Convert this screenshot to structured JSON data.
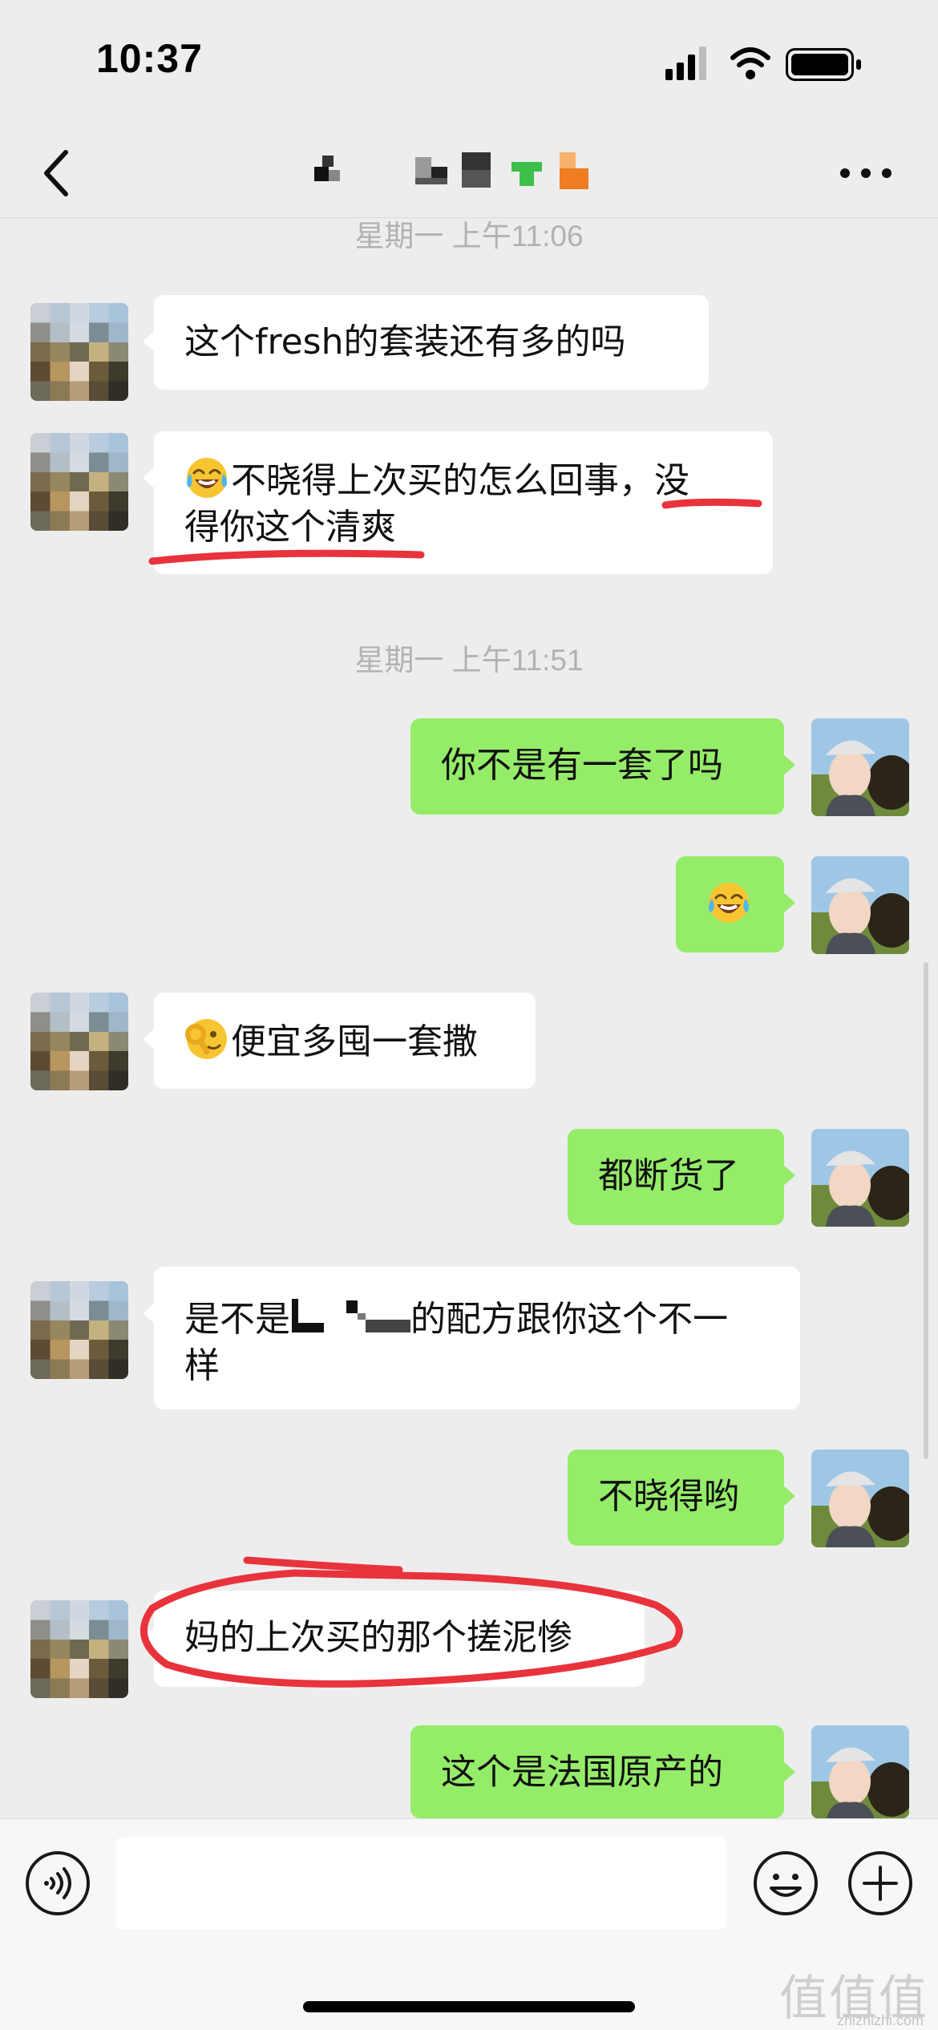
{
  "status_bar": {
    "time": "10:37",
    "icons": [
      "cellular-signal-icon",
      "wifi-icon",
      "battery-icon"
    ]
  },
  "nav": {
    "title": "",
    "back_icon": "chevron-left-icon",
    "more_icon": "more-dots-icon"
  },
  "messages": [
    {
      "type": "time",
      "text": "星期一 上午11:06"
    },
    {
      "type": "in",
      "lines": [
        "这个fresh的套装还有多的吗"
      ]
    },
    {
      "type": "in",
      "emoji": "tears-of-joy-emoji",
      "lines": [
        "不晓得上次买的怎么回事，没",
        "得你这个清爽"
      ],
      "annotation": "red-underline"
    },
    {
      "type": "time",
      "text": "星期一 上午11:51"
    },
    {
      "type": "out",
      "lines": [
        "你不是有一套了吗"
      ]
    },
    {
      "type": "out",
      "emoji": "tears-of-joy-emoji",
      "lines": [
        ""
      ]
    },
    {
      "type": "in",
      "emoji": "ok-hand-face-emoji",
      "lines": [
        "便宜多囤一套撒"
      ]
    },
    {
      "type": "out",
      "lines": [
        "都断货了"
      ]
    },
    {
      "type": "in",
      "lines": [
        "是不是",
        "的配方跟你这个不一",
        "样"
      ],
      "redacted": true
    },
    {
      "type": "out",
      "lines": [
        "不晓得哟"
      ]
    },
    {
      "type": "in",
      "lines": [
        "妈的上次买的那个搓泥惨"
      ],
      "annotation": "red-circle"
    },
    {
      "type": "out",
      "lines": [
        "这个是法国原产的"
      ]
    }
  ],
  "input_bar": {
    "voice_icon": "voice-icon",
    "input_value": "",
    "emoji_icon": "smiley-icon",
    "plus_icon": "plus-icon"
  },
  "watermark": {
    "logo": "值值值",
    "url": "zhizhizhi.com"
  },
  "colors": {
    "background": "#ededed",
    "bubble_out": "#95ec69",
    "bubble_in": "#ffffff",
    "annotation": "#e8333c"
  }
}
